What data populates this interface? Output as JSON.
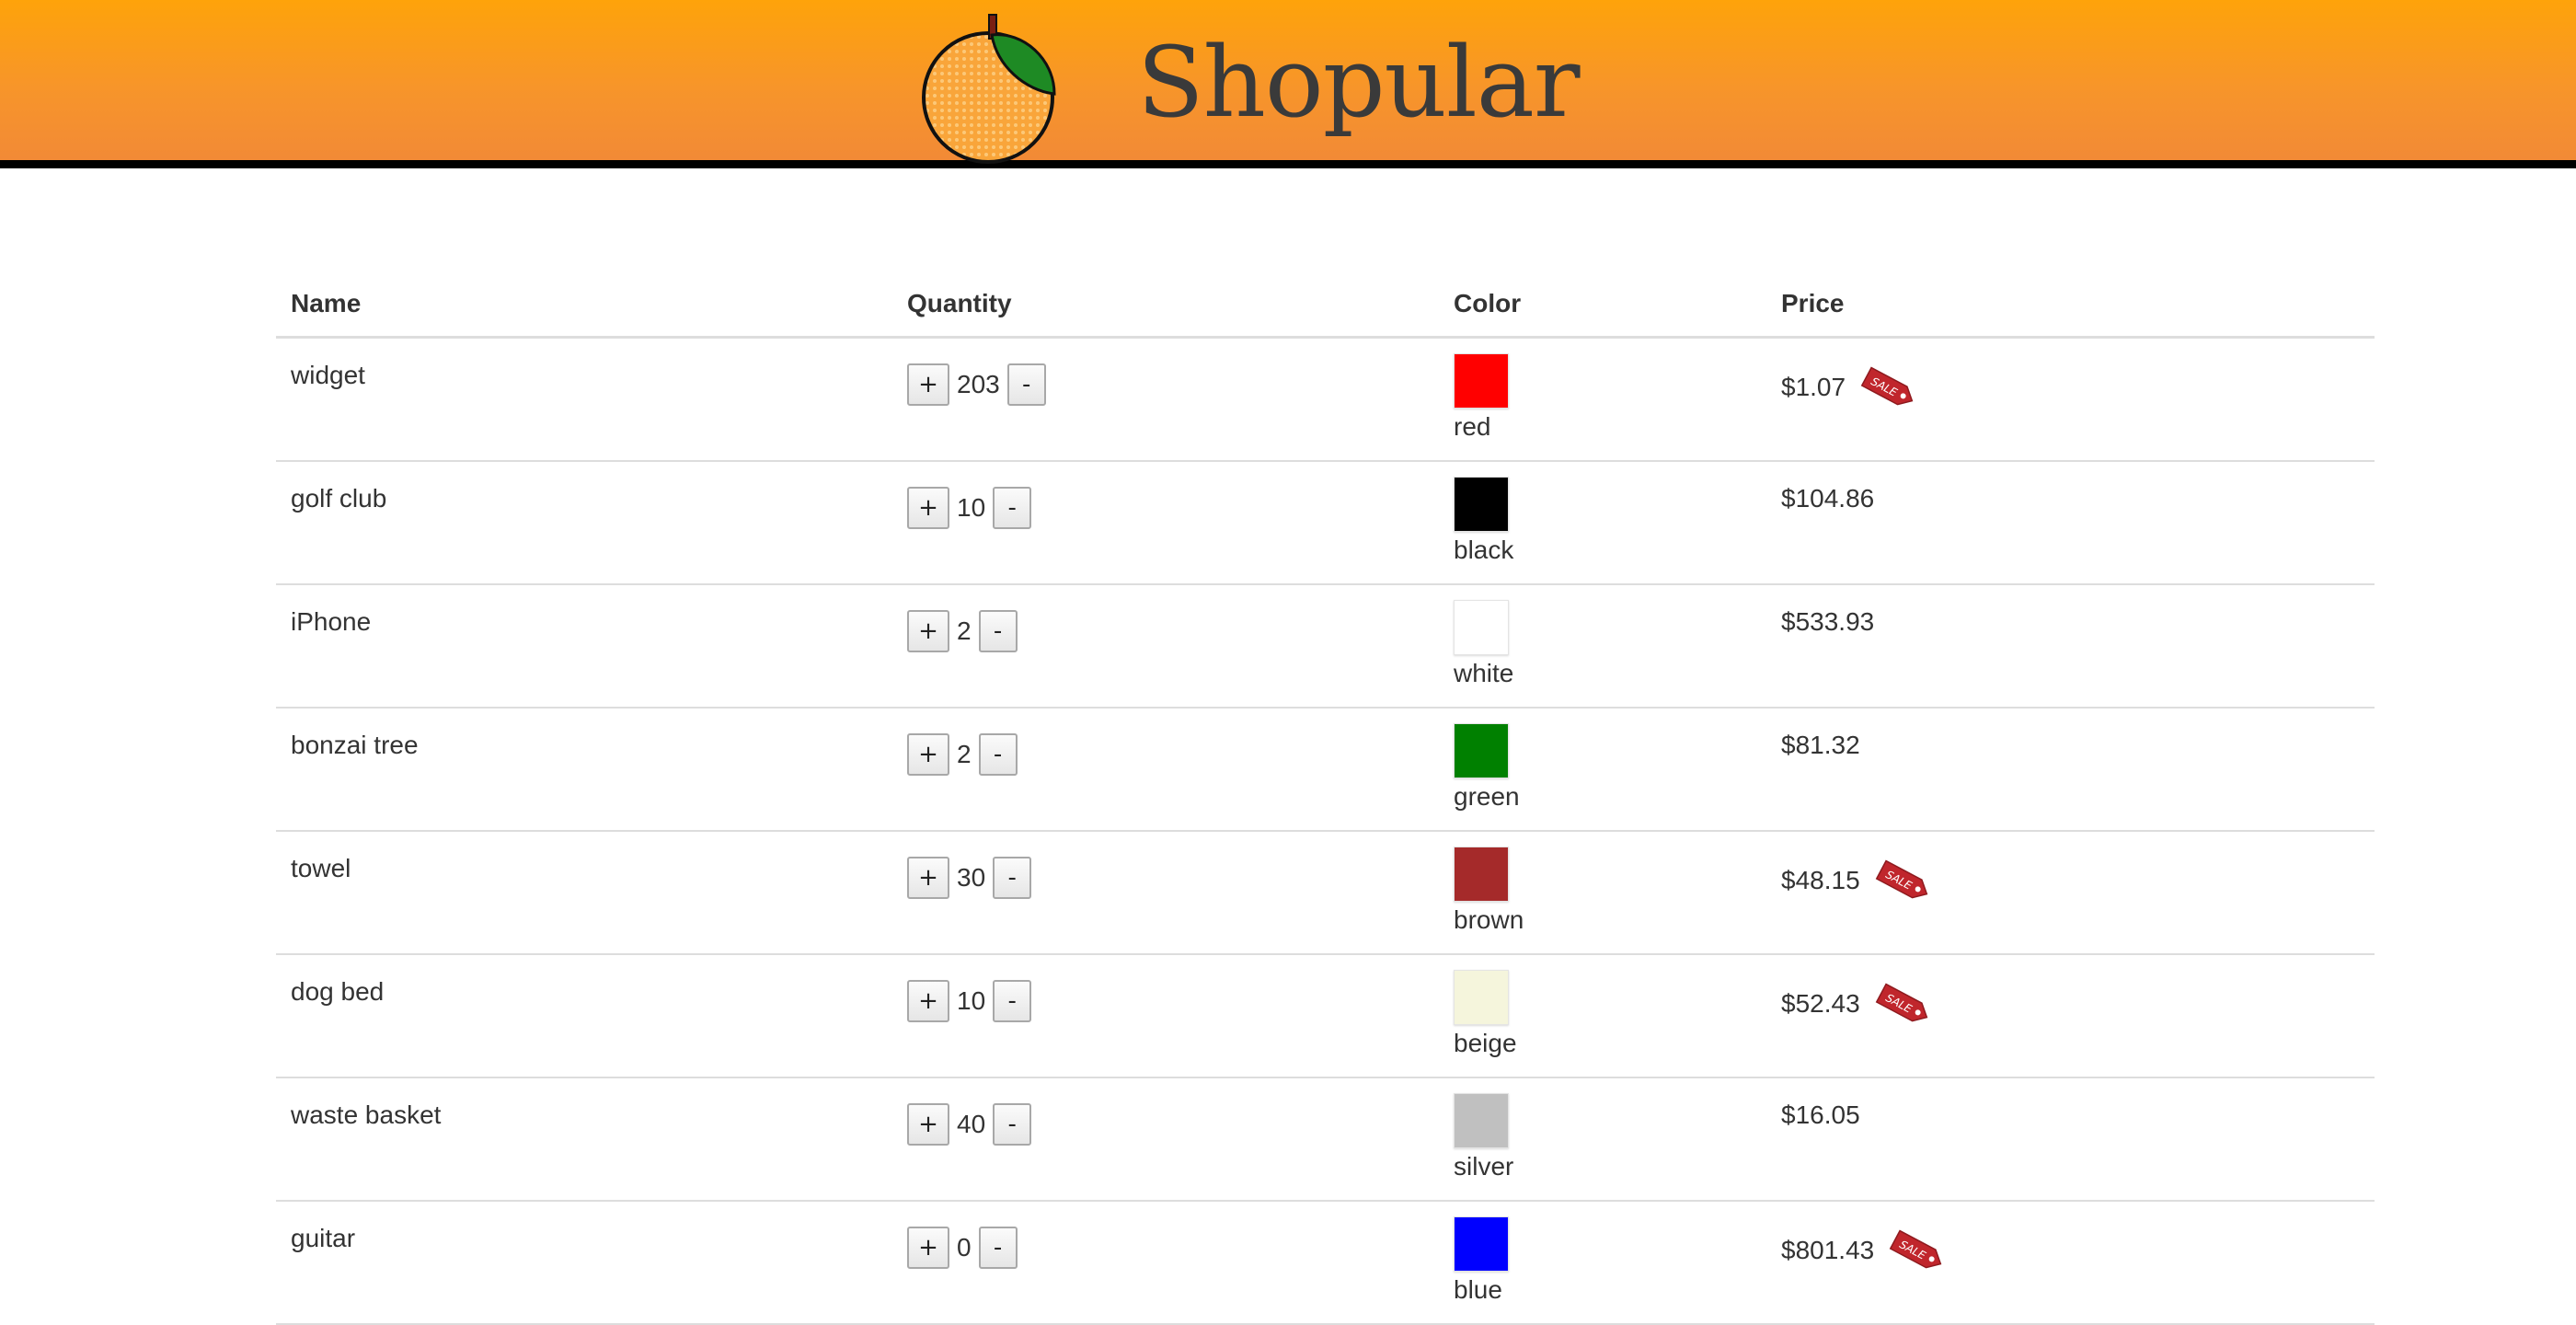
{
  "header": {
    "brand": "Shopular"
  },
  "table": {
    "columns": [
      "Name",
      "Quantity",
      "Color",
      "Price"
    ],
    "rows": [
      {
        "name": "widget",
        "quantity": "203",
        "color_name": "red",
        "color_hex": "#ff0000",
        "price": "$1.07",
        "on_sale": true
      },
      {
        "name": "golf club",
        "quantity": "10",
        "color_name": "black",
        "color_hex": "#000000",
        "price": "$104.86",
        "on_sale": false
      },
      {
        "name": "iPhone",
        "quantity": "2",
        "color_name": "white",
        "color_hex": "#ffffff",
        "price": "$533.93",
        "on_sale": false
      },
      {
        "name": "bonzai tree",
        "quantity": "2",
        "color_name": "green",
        "color_hex": "#008000",
        "price": "$81.32",
        "on_sale": false
      },
      {
        "name": "towel",
        "quantity": "30",
        "color_name": "brown",
        "color_hex": "#a52a2a",
        "price": "$48.15",
        "on_sale": true
      },
      {
        "name": "dog bed",
        "quantity": "10",
        "color_name": "beige",
        "color_hex": "#f5f5dc",
        "price": "$52.43",
        "on_sale": true
      },
      {
        "name": "waste basket",
        "quantity": "40",
        "color_name": "silver",
        "color_hex": "#c0c0c0",
        "price": "$16.05",
        "on_sale": false
      },
      {
        "name": "guitar",
        "quantity": "0",
        "color_name": "blue",
        "color_hex": "#0000ff",
        "price": "$801.43",
        "on_sale": true
      }
    ],
    "plus_label": "+",
    "minus_label": "-",
    "sale_tag_text": "SALE"
  },
  "colors": {
    "header_top": "#fea30a",
    "header_bottom": "#f28a36",
    "header_rule": "#000000",
    "row_divider": "#dddddd"
  }
}
